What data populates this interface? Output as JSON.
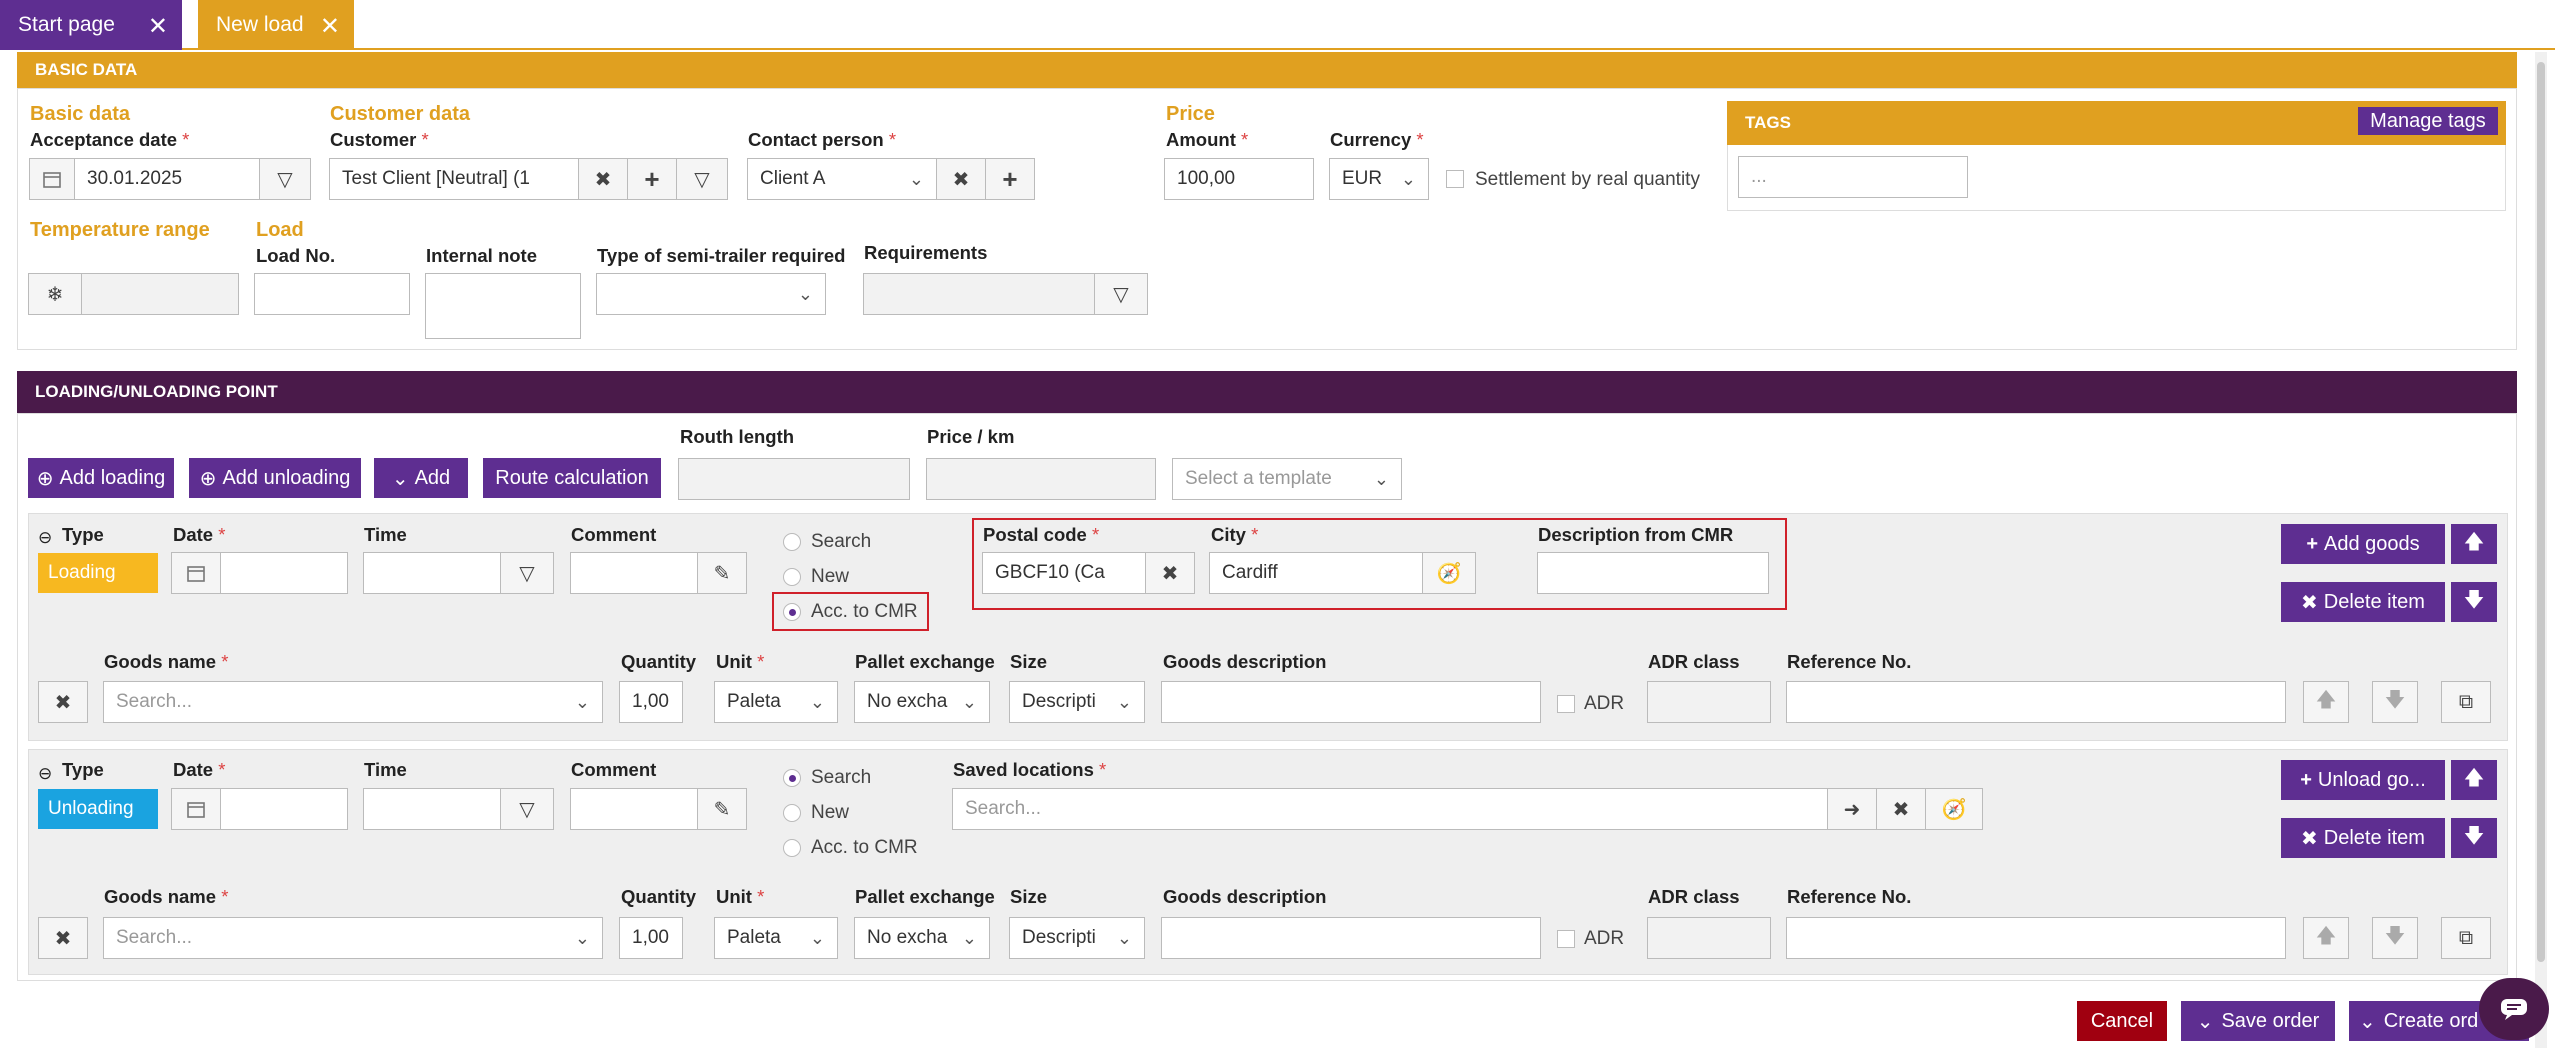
{
  "tabs": [
    {
      "label": "Start page",
      "close": "✕"
    },
    {
      "label": "New load",
      "close": "✕"
    }
  ],
  "basic": {
    "header": "BASIC DATA",
    "group_basic": "Basic data",
    "acceptance_label": "Acceptance date",
    "acceptance_value": "30.01.2025",
    "group_customer": "Customer data",
    "customer_label": "Customer",
    "customer_value": "Test Client [Neutral] (1",
    "contact_label": "Contact person",
    "contact_value": "Client A",
    "group_price": "Price",
    "amount_label": "Amount",
    "amount_value": "100,00",
    "currency_label": "Currency",
    "currency_value": "EUR",
    "settlement_label": "Settlement by real quantity",
    "tags_header": "TAGS",
    "manage_tags": "Manage tags",
    "tags_placeholder": "...",
    "group_temp": "Temperature range",
    "group_load": "Load",
    "load_no_label": "Load No.",
    "internal_note_label": "Internal note",
    "semitrailer_label": "Type of semi-trailer required",
    "requirements_label": "Requirements"
  },
  "points": {
    "header": "LOADING/UNLOADING POINT",
    "add_loading": "Add loading",
    "add_unloading": "Add unloading",
    "add": "Add",
    "route_calc": "Route calculation",
    "route_length_label": "Routh length",
    "price_km_label": "Price / km",
    "template_placeholder": "Select a template"
  },
  "common": {
    "type_label": "Type",
    "date_label": "Date",
    "time_label": "Time",
    "comment_label": "Comment",
    "radio_search": "Search",
    "radio_new": "New",
    "radio_cmr": "Acc. to CMR",
    "goods_name_label": "Goods name",
    "goods_placeholder": "Search...",
    "quantity_label": "Quantity",
    "quantity_value": "1,00",
    "unit_label": "Unit",
    "unit_value": "Paleta",
    "pallet_label": "Pallet exchange",
    "pallet_value": "No excha",
    "size_label": "Size",
    "size_value": "Descripti",
    "goods_desc_label": "Goods description",
    "adr_class_label": "ADR class",
    "adr_label": "ADR",
    "reference_label": "Reference No.",
    "delete_item": "Delete item"
  },
  "loading": {
    "type_value": "Loading",
    "type_color": "#f7b820",
    "postal_label": "Postal code",
    "postal_value": "GBCF10 (Ca",
    "city_label": "City",
    "city_value": "Cardiff",
    "cmr_desc_label": "Description from CMR",
    "add_goods": "Add goods"
  },
  "unloading": {
    "type_value": "Unloading",
    "type_color": "#1aa3e0",
    "saved_label": "Saved locations",
    "saved_placeholder": "Search...",
    "unload_goods": "Unload go..."
  },
  "footer": {
    "cancel": "Cancel",
    "save": "Save order",
    "create": "Create ord"
  }
}
